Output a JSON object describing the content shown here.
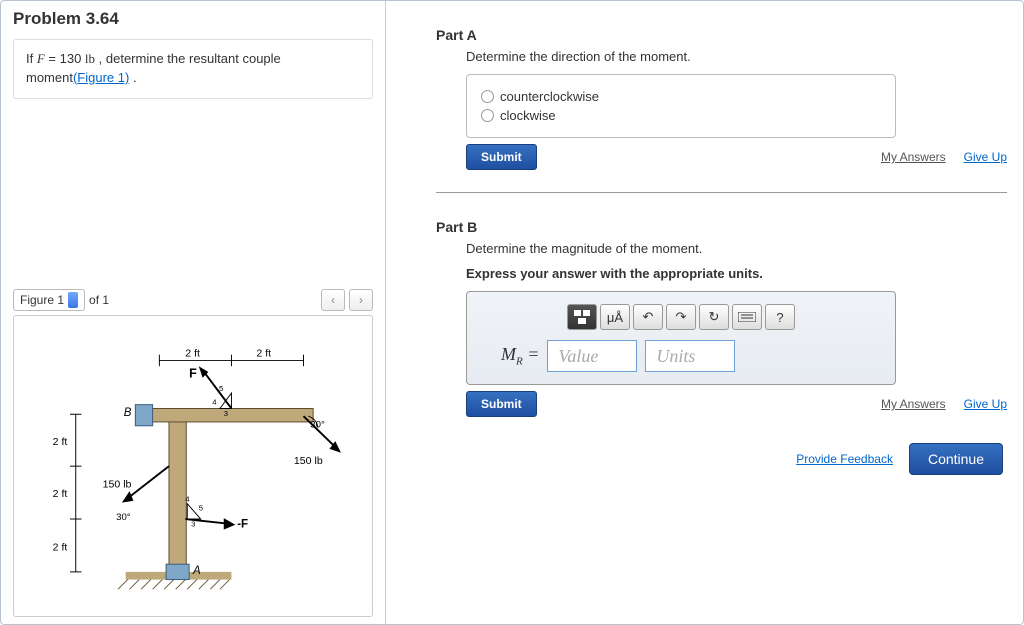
{
  "problem": {
    "title": "Problem 3.64",
    "statement_pre": "If ",
    "variable": "F",
    "equals": " = 130 ",
    "unit": "lb",
    "statement_post": " , determine the resultant couple moment",
    "figlink": "(Figure 1)",
    "period": " ."
  },
  "figurebar": {
    "label": "Figure 1",
    "of": "of 1"
  },
  "diagram": {
    "dim_top_l": "2 ft",
    "dim_top_r": "2 ft",
    "F_top": "F",
    "B": "B",
    "ang30a": "30°",
    "load1": "150 lb",
    "dim_l1": "2 ft",
    "load2": "150 lb",
    "dim_l2": "2 ft",
    "ang30b": "30°",
    "neg_F": "-F",
    "dim_l3": "2 ft",
    "A": "A",
    "tick3": "3",
    "tick4": "4",
    "tick5": "5"
  },
  "partA": {
    "label": "Part A",
    "prompt": "Determine the direction of the moment.",
    "opt1": "counterclockwise",
    "opt2": "clockwise",
    "submit": "Submit",
    "myans": "My Answers",
    "giveup": "Give Up"
  },
  "partB": {
    "label": "Part B",
    "prompt": "Determine the magnitude of the moment.",
    "hint": "Express your answer with the appropriate units.",
    "var": "M",
    "sub": "R",
    "eq": " = ",
    "ph_val": "Value",
    "ph_units": "Units",
    "submit": "Submit",
    "myans": "My Answers",
    "giveup": "Give Up",
    "tb_mu": "μÅ",
    "tb_q": "?"
  },
  "footer": {
    "feedback": "Provide Feedback",
    "cont": "Continue"
  }
}
